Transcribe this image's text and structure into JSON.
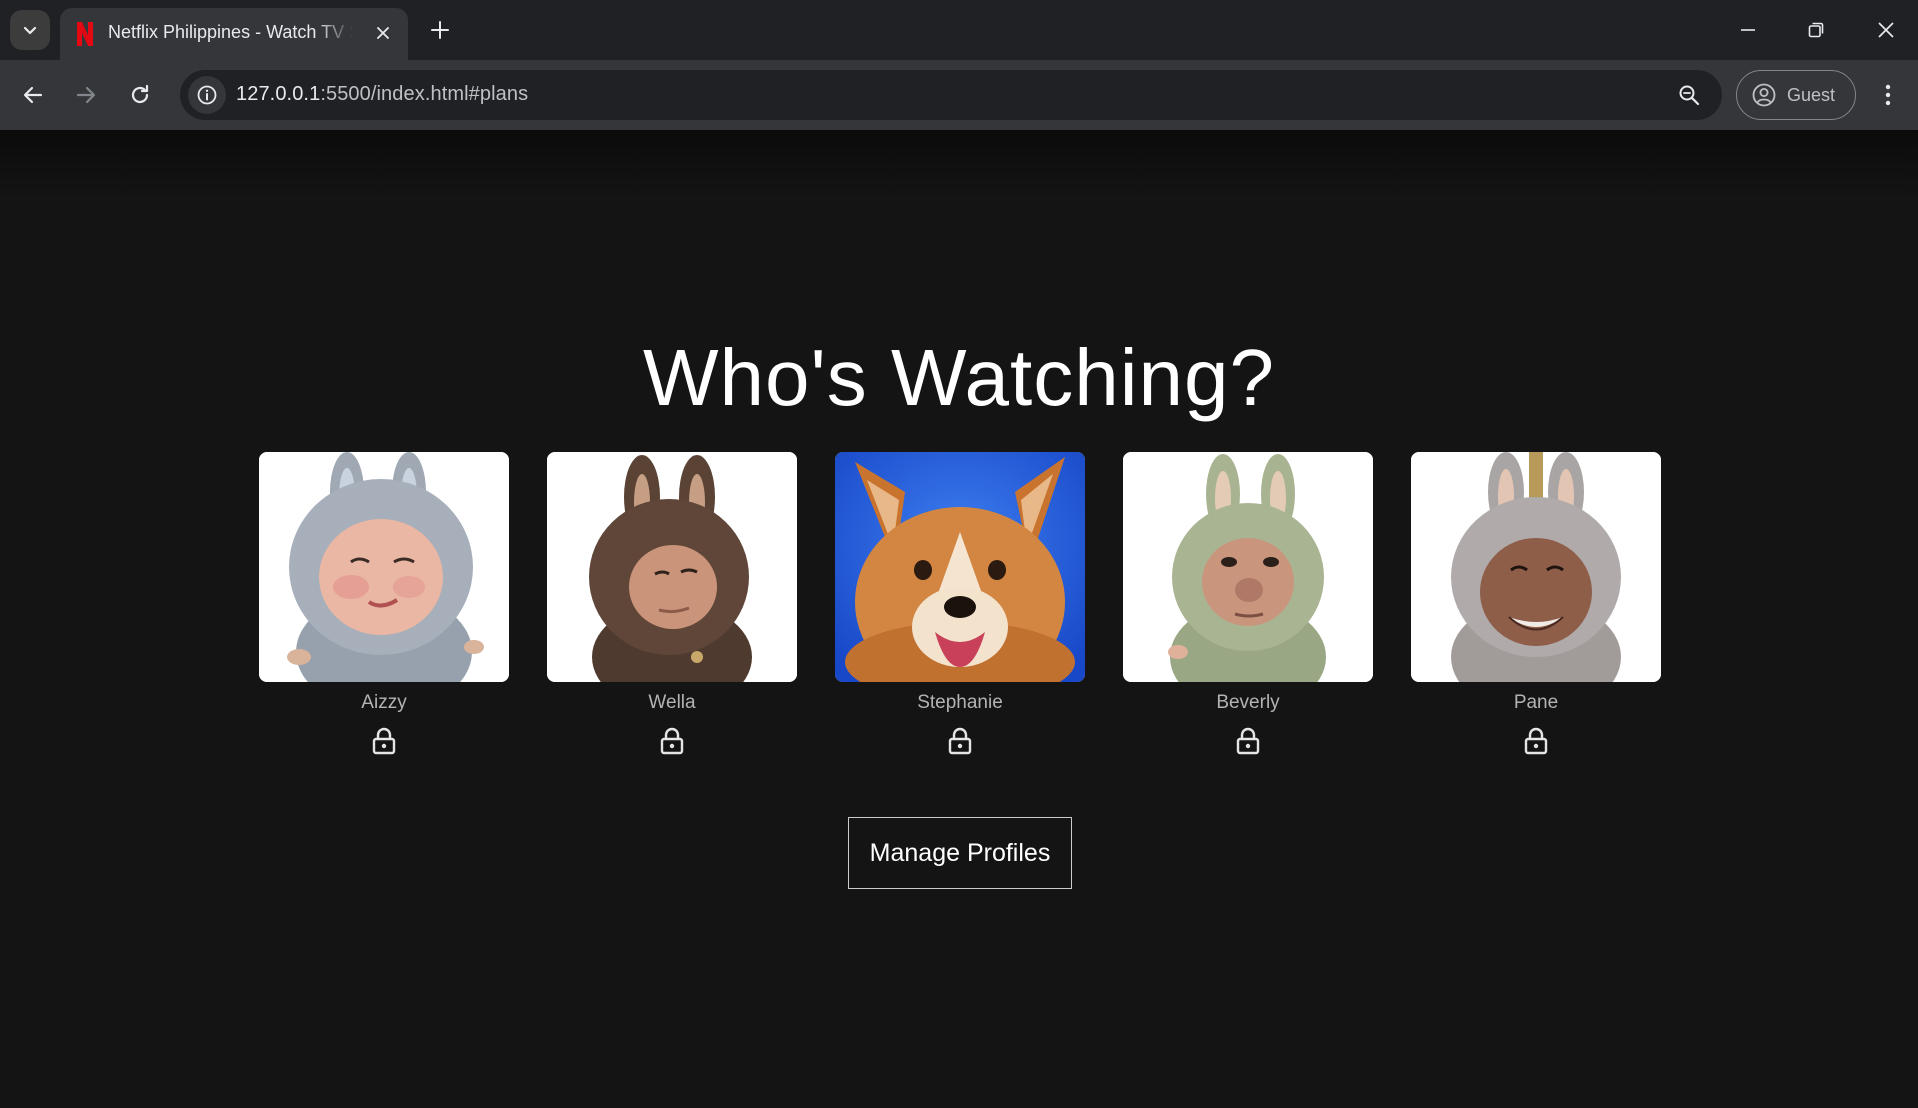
{
  "browser": {
    "tab_title": "Netflix Philippines - Watch TV Shows Online",
    "url_host": "127.0.0.1",
    "url_rest": ":5500/index.html#plans",
    "profile_label": "Guest",
    "icons": {
      "tab_list": "chevron-down-icon",
      "favicon": "netflix-n-icon",
      "tab_close": "close-icon",
      "new_tab": "plus-icon",
      "minimize": "minimize-icon",
      "restore": "restore-icon",
      "close_window": "close-icon",
      "back": "arrow-left-icon",
      "forward": "arrow-right-icon",
      "reload": "reload-icon",
      "site_info": "info-icon",
      "zoom": "zoom-icon",
      "profile": "account-circle-icon",
      "menu": "kebab-menu-icon"
    }
  },
  "page": {
    "heading": "Who's Watching?",
    "profiles": [
      {
        "name": "Aizzy",
        "avatar": "gray bunny costume with face",
        "locked": true
      },
      {
        "name": "Wella",
        "avatar": "brown bunny costume with face",
        "locked": true
      },
      {
        "name": "Stephanie",
        "avatar": "corgi dog on blue background",
        "locked": true
      },
      {
        "name": "Beverly",
        "avatar": "green bunny costume with face",
        "locked": true
      },
      {
        "name": "Pane",
        "avatar": "gray bunny costume with face",
        "locked": true
      }
    ],
    "manage_button": "Manage Profiles"
  },
  "colors": {
    "background": "#141414",
    "netflix_red": "#e50914",
    "chrome_dark": "#202124",
    "chrome_mid": "#35363a",
    "name_text": "#b3b3b3"
  }
}
